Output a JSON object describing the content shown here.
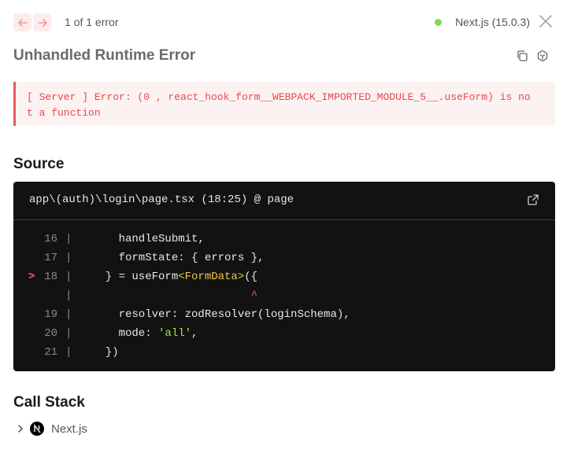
{
  "header": {
    "error_count": "1 of 1 error",
    "version": "Next.js (15.0.3)",
    "status_color": "#7ed957",
    "nav_prev_icon": "arrow-left-icon",
    "nav_next_icon": "arrow-right-icon",
    "close_icon": "close-icon"
  },
  "title": "Unhandled Runtime Error",
  "title_actions": [
    "copy-icon",
    "bug-report-icon"
  ],
  "error_message": "[ Server ] Error: (0 , react_hook_form__WEBPACK_IMPORTED_MODULE_5__.useForm) is not a function",
  "source": {
    "heading": "Source",
    "file": "app\\(auth)\\login\\page.tsx (18:25) @ page",
    "open_icon": "external-link-icon",
    "lines": [
      {
        "marker": "",
        "num": "16",
        "gutter": "|",
        "parts": [
          {
            "t": "    handleSubmit,",
            "c": ""
          }
        ]
      },
      {
        "marker": "",
        "num": "17",
        "gutter": "|",
        "parts": [
          {
            "t": "    formState: { errors },",
            "c": ""
          }
        ]
      },
      {
        "marker": ">",
        "num": "18",
        "gutter": "|",
        "parts": [
          {
            "t": "  } = useForm",
            "c": ""
          },
          {
            "t": "<FormData>",
            "c": "tok-type"
          },
          {
            "t": "({",
            "c": ""
          }
        ]
      },
      {
        "marker": "",
        "num": "",
        "gutter": "|",
        "parts": [
          {
            "t": "                        ^",
            "c": "tok-caret"
          }
        ]
      },
      {
        "marker": "",
        "num": "19",
        "gutter": "|",
        "parts": [
          {
            "t": "    resolver: zodResolver(loginSchema),",
            "c": ""
          }
        ]
      },
      {
        "marker": "",
        "num": "20",
        "gutter": "|",
        "parts": [
          {
            "t": "    mode: ",
            "c": ""
          },
          {
            "t": "'all'",
            "c": "tok-string"
          },
          {
            "t": ",",
            "c": ""
          }
        ]
      },
      {
        "marker": "",
        "num": "21",
        "gutter": "|",
        "parts": [
          {
            "t": "  })",
            "c": ""
          }
        ]
      }
    ]
  },
  "call_stack": {
    "heading": "Call Stack",
    "items": [
      {
        "label": "Next.js",
        "icon": "nextjs-logo-icon",
        "expand_icon": "chevron-right-icon"
      }
    ]
  }
}
